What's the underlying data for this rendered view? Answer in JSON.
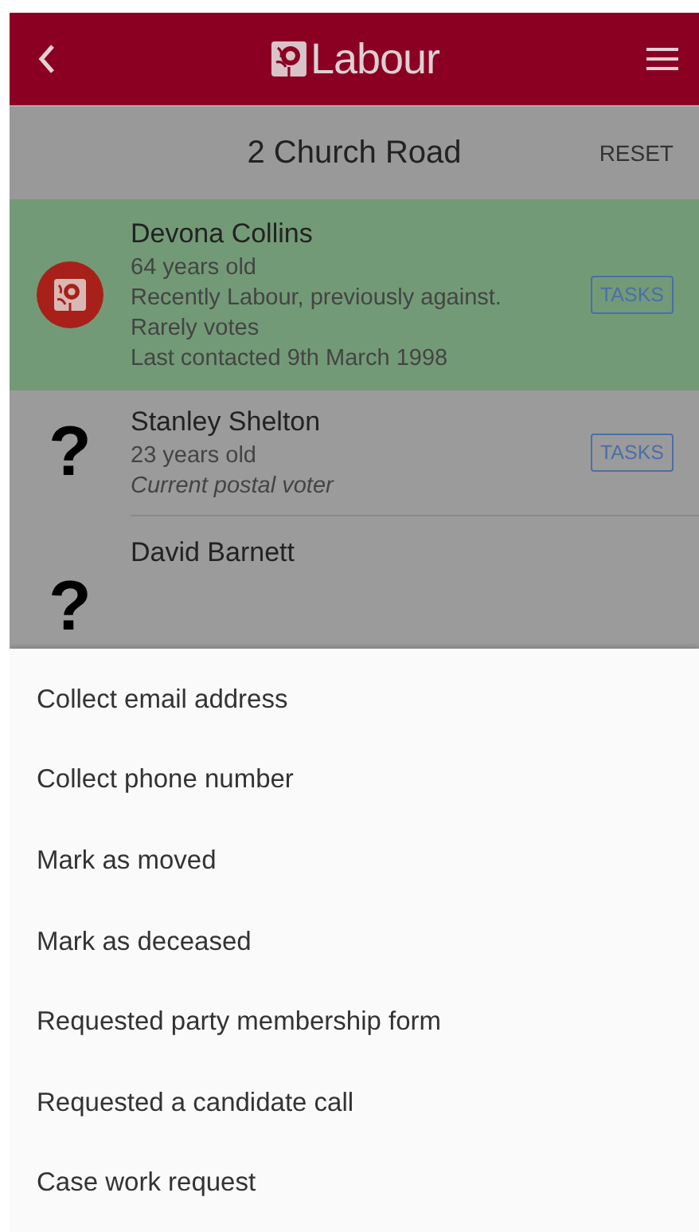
{
  "header": {
    "logo_text": "Labour"
  },
  "address_bar": {
    "title": "2 Church Road",
    "action": "RESET"
  },
  "people": [
    {
      "name": "Devona Collins",
      "kind": "member",
      "selected": true,
      "lines": [
        {
          "text": "64 years old",
          "kind": "plain"
        },
        {
          "text": "Recently Labour, previously against.",
          "kind": "plain"
        },
        {
          "text": "Rarely votes",
          "kind": "plain"
        },
        {
          "text": "Last contacted 9th March 1998",
          "kind": "plain"
        }
      ],
      "action": "TASKS"
    },
    {
      "name": "Stanley Shelton",
      "kind": "unknown",
      "badge": "?",
      "selected": false,
      "lines": [
        {
          "text": "23 years old",
          "kind": "plain"
        },
        {
          "text": "Current postal voter",
          "kind": "note"
        }
      ],
      "action": "TASKS"
    },
    {
      "name": "David Barnett",
      "kind": "unknown",
      "badge": "?",
      "selected": false
    }
  ],
  "sheet": {
    "items": [
      "Collect email address",
      "Collect phone number",
      "Mark as moved",
      "Mark as deceased",
      "Requested party membership form",
      "Requested a candidate call",
      "Case work request"
    ]
  }
}
